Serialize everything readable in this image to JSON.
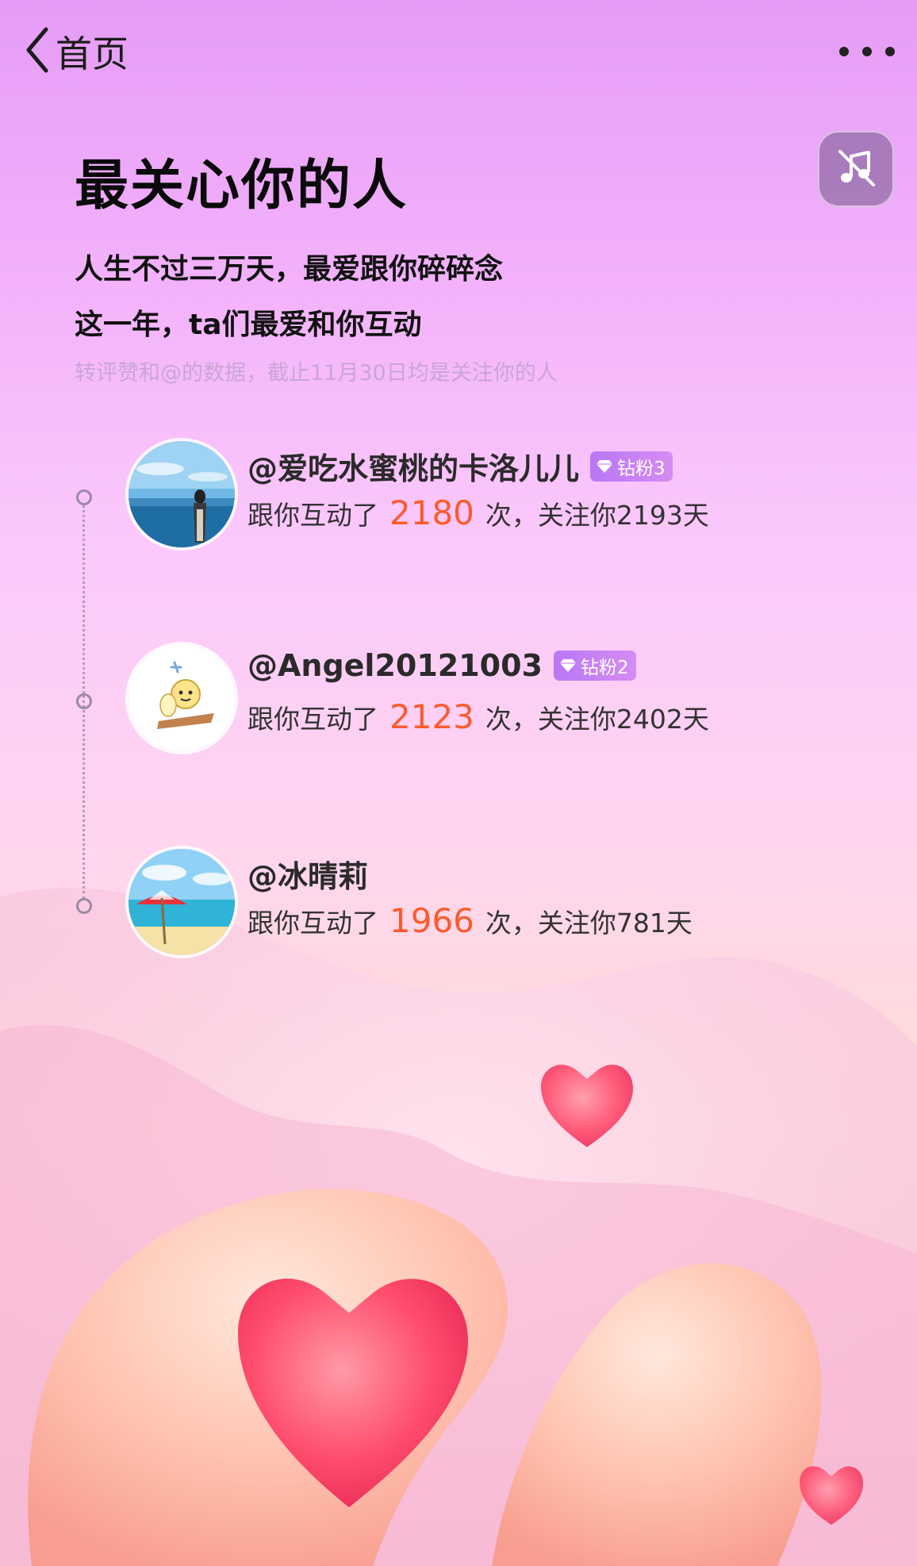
{
  "nav": {
    "back_label": "首页"
  },
  "header": {
    "title": "最关心你的人",
    "subtitle_line1": "人生不过三万天，最爱跟你碎碎念",
    "subtitle_line2": "这一年，ta们最爱和你互动",
    "note": "转评赞和@的数据，截止11月30日均是关注你的人"
  },
  "people": [
    {
      "name": "@爱吃水蜜桃的卡洛儿儿",
      "badge": "钻粉3",
      "stat_prefix": "跟你互动了",
      "count": "2180",
      "stat_suffix": "次，关注你2193天"
    },
    {
      "name": "@Angel20121003",
      "badge": "钻粉2",
      "stat_prefix": "跟你互动了",
      "count": "2123",
      "stat_suffix": "次，关注你2402天"
    },
    {
      "name": "@冰晴莉",
      "stat_prefix": "跟你互动了",
      "count": "1966",
      "stat_suffix": "次，关注你781天"
    }
  ],
  "icons": {
    "back": "chevron-left-icon",
    "more": "more-dots-icon",
    "music": "music-off-icon",
    "badge": "diamond-icon"
  },
  "colors": {
    "count": "#fb5b2c",
    "badge": "#c07df4",
    "note": "#c9a6d6"
  }
}
